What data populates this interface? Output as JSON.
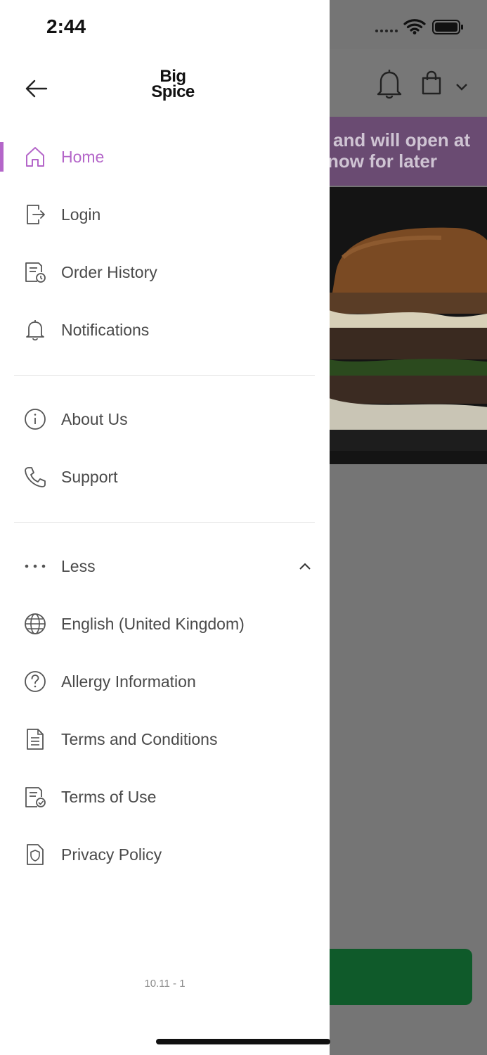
{
  "status_bar": {
    "time": "2:44"
  },
  "logo": {
    "line1": "Big",
    "line2": "Spice"
  },
  "menu": {
    "primary": [
      {
        "label": "Home",
        "icon": "home-icon",
        "active": true
      },
      {
        "label": "Login",
        "icon": "login-icon"
      },
      {
        "label": "Order History",
        "icon": "order-history-icon"
      },
      {
        "label": "Notifications",
        "icon": "bell-icon"
      }
    ],
    "secondary": [
      {
        "label": "About Us",
        "icon": "info-icon"
      },
      {
        "label": "Support",
        "icon": "phone-icon"
      }
    ],
    "more": [
      {
        "label": "Less",
        "icon": "more-dots-icon"
      },
      {
        "label": "English (United Kingdom)",
        "icon": "globe-icon"
      },
      {
        "label": "Allergy Information",
        "icon": "question-icon"
      },
      {
        "label": "Terms and Conditions",
        "icon": "document-list-icon"
      },
      {
        "label": "Terms of Use",
        "icon": "document-check-icon"
      },
      {
        "label": "Privacy Policy",
        "icon": "shield-document-icon"
      }
    ]
  },
  "version": "10.11 - 1",
  "background": {
    "banner_line1": "and will open at",
    "banner_line2": "now for later"
  },
  "colors": {
    "accent": "#b466c9",
    "text": "#4a4a4a",
    "cta_green": "#0f5a2a"
  }
}
